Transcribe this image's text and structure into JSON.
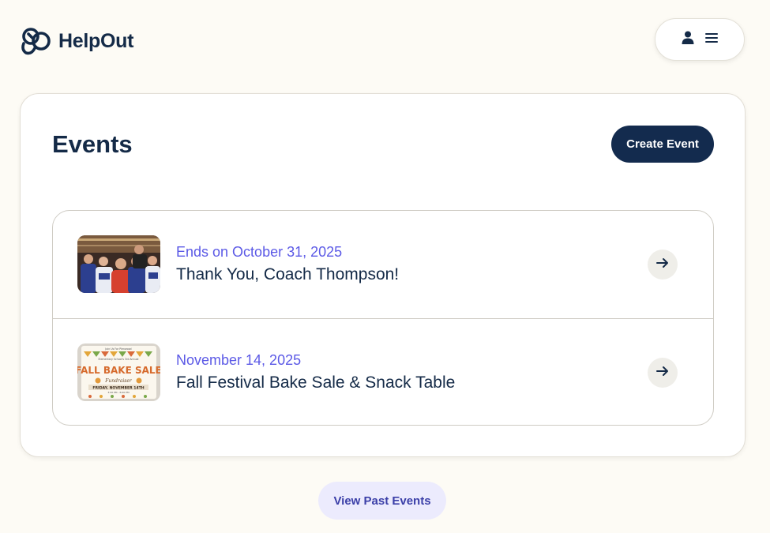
{
  "app": {
    "name": "HelpOut"
  },
  "header": {
    "logo_icon": "helpout-logo-icon",
    "user_icon": "person-icon",
    "menu_icon": "hamburger-menu-icon"
  },
  "main": {
    "title": "Events",
    "create_button_label": "Create Event",
    "events": [
      {
        "date": "Ends on October 31, 2025",
        "title": "Thank You, Coach Thompson!",
        "thumbnail": "basketball-team-photo",
        "action_icon": "arrow-right-icon"
      },
      {
        "date": "November 14, 2025",
        "title": "Fall Festival Bake Sale & Snack Table",
        "thumbnail": "bake-sale-flyer",
        "thumbnail_text": {
          "top": "Join Us For Plenwood",
          "top2": "Elementary School's 3rd Annual",
          "headline": "FALL BAKE SALE",
          "sub": "Fundraiser",
          "date_line": "FRIDAY, NOVEMBER 14TH",
          "time": "3:00 PM - 6:00 PM"
        },
        "action_icon": "arrow-right-icon"
      }
    ]
  },
  "footer": {
    "past_events_label": "View Past Events"
  },
  "colors": {
    "background": "#fdfbf5",
    "primary": "#132b4e",
    "accent": "#5b59e6",
    "secondary_button": "#ecebfd"
  }
}
